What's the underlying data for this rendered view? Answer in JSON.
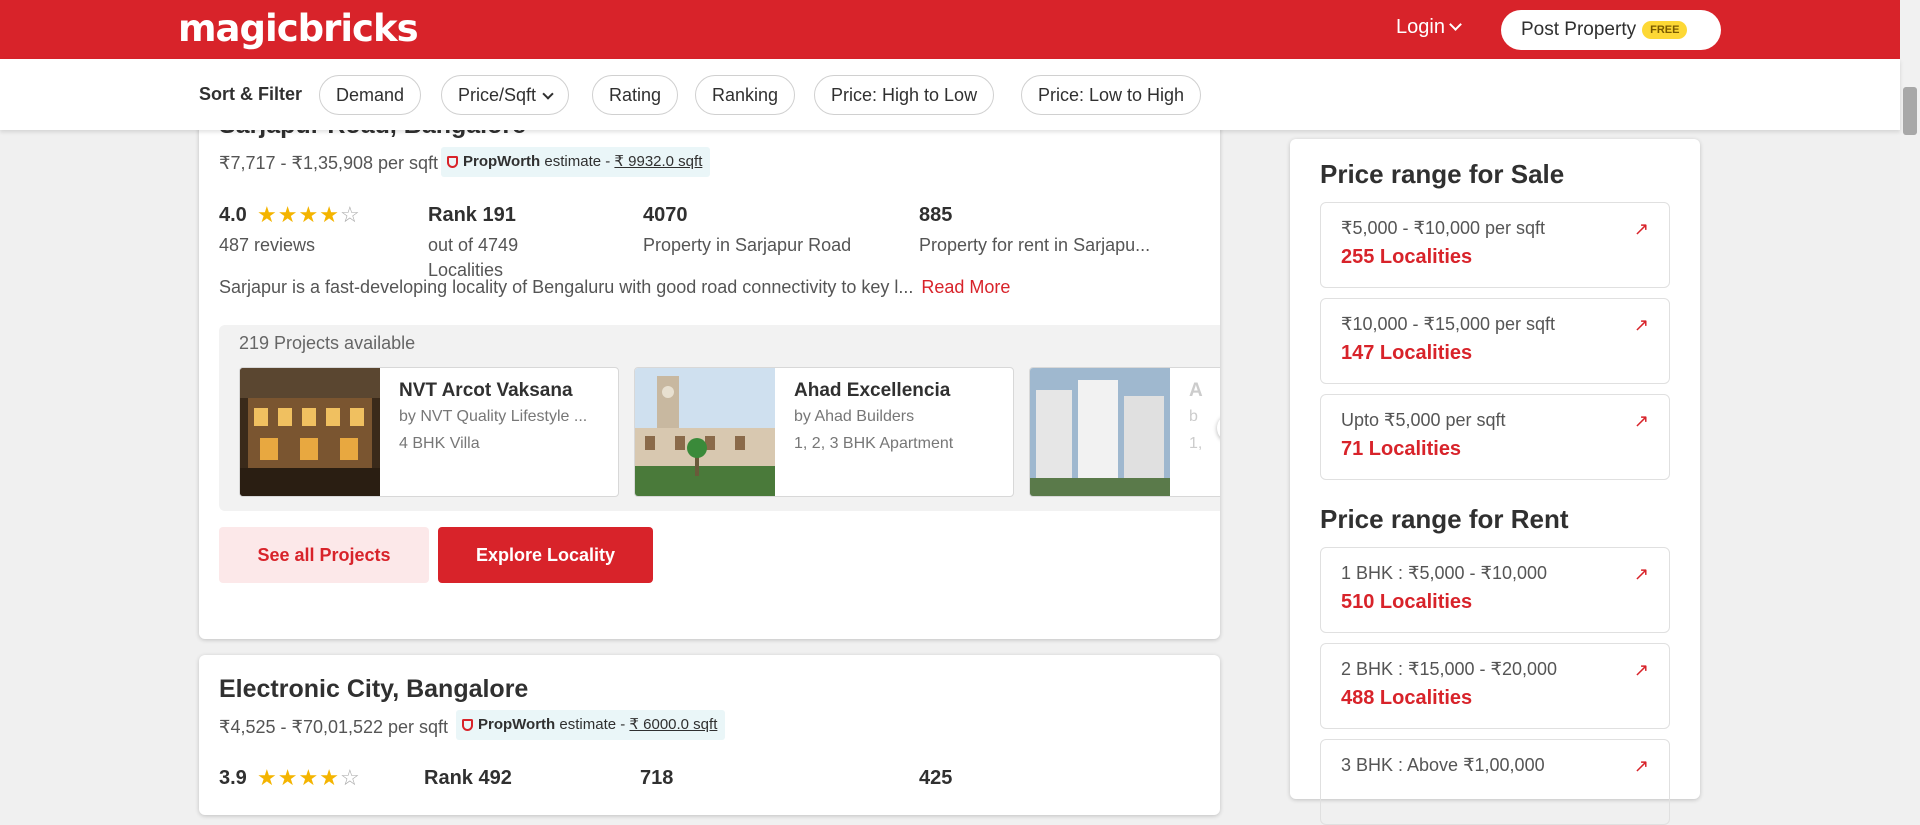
{
  "header": {
    "logo": "magicbricks",
    "login_label": "Login",
    "post_property_label": "Post Property",
    "free_badge": "FREE"
  },
  "filter_bar": {
    "label": "Sort & Filter",
    "chips": [
      "Demand",
      "Price/Sqft",
      "Rating",
      "Ranking",
      "Price: High to Low",
      "Price: Low to High"
    ]
  },
  "localities": [
    {
      "title": "Sarjapur Road, Bangalore",
      "price_range": "₹7,717 - ₹1,35,908 per sqft",
      "propworth_brand": "PropWorth",
      "propworth_text": "estimate -",
      "propworth_value": "₹ 9932.0 sqft",
      "rating": "4.0",
      "stars_filled": 4,
      "reviews": "487 reviews",
      "rank": "Rank 191",
      "rank_sub": "out of 4749 Localities",
      "property_count": "4070",
      "property_label": "Property in Sarjapur Road",
      "rent_count": "885",
      "rent_label": "Property for rent in Sarjapu...",
      "description": "Sarjapur is a fast-developing locality of Bengaluru with good road connectivity to key l...",
      "read_more": "Read More",
      "projects_available": "219 Projects available",
      "projects": [
        {
          "name": "NVT Arcot Vaksana",
          "builder": "by NVT Quality Lifestyle ...",
          "type": "4 BHK Villa"
        },
        {
          "name": "Ahad Excellencia",
          "builder": "by Ahad Builders",
          "type": "1, 2, 3 BHK Apartment"
        },
        {
          "name": "A",
          "builder": "b",
          "type": "1,"
        }
      ],
      "see_all_label": "See all Projects",
      "explore_label": "Explore Locality"
    },
    {
      "title": "Electronic City, Bangalore",
      "price_range": "₹4,525 - ₹70,01,522 per sqft",
      "propworth_brand": "PropWorth",
      "propworth_text": "estimate -",
      "propworth_value": "₹ 6000.0 sqft",
      "rating": "3.9",
      "stars_filled": 3.5,
      "rank": "Rank 492",
      "property_count": "718",
      "rent_count": "425"
    }
  ],
  "sidebar": {
    "sale_heading": "Price range for Sale",
    "sale_ranges": [
      {
        "label": "₹5,000 - ₹10,000 per sqft",
        "count": "255 Localities"
      },
      {
        "label": "₹10,000 - ₹15,000 per sqft",
        "count": "147 Localities"
      },
      {
        "label": "Upto ₹5,000 per sqft",
        "count": "71 Localities"
      }
    ],
    "rent_heading": "Price range for Rent",
    "rent_ranges": [
      {
        "label": "1 BHK : ₹5,000 - ₹10,000",
        "count": "510 Localities"
      },
      {
        "label": "2 BHK : ₹15,000 - ₹20,000",
        "count": "488 Localities"
      },
      {
        "label": "3 BHK : Above ₹1,00,000",
        "count": ""
      }
    ]
  },
  "colors": {
    "brand_red": "#d8232a",
    "propworth_bg": "#eaf6f8",
    "star": "#f4b400"
  }
}
